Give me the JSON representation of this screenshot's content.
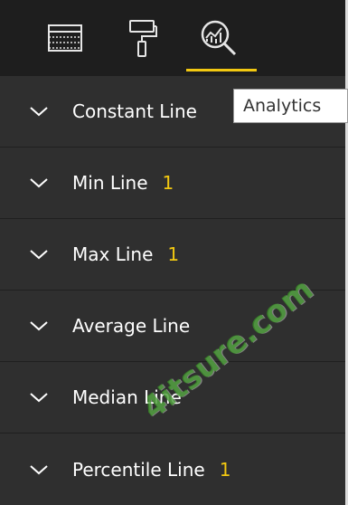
{
  "tabs": [
    {
      "name": "fields",
      "icon": "fields-icon",
      "active": false
    },
    {
      "name": "format",
      "icon": "paint-roller-icon",
      "active": false
    },
    {
      "name": "analytics",
      "icon": "analytics-icon",
      "active": true
    }
  ],
  "tooltip": "Analytics",
  "sections": [
    {
      "label": "Constant Line",
      "count": ""
    },
    {
      "label": "Min Line",
      "count": "1"
    },
    {
      "label": "Max Line",
      "count": "1"
    },
    {
      "label": "Average Line",
      "count": ""
    },
    {
      "label": "Median Line",
      "count": ""
    },
    {
      "label": "Percentile Line",
      "count": "1"
    }
  ],
  "watermark": "4itsure.com",
  "colors": {
    "panel": "#2f2f2f",
    "tabbar": "#1e1e1e",
    "accent": "#f2c811",
    "text": "#ffffff"
  }
}
